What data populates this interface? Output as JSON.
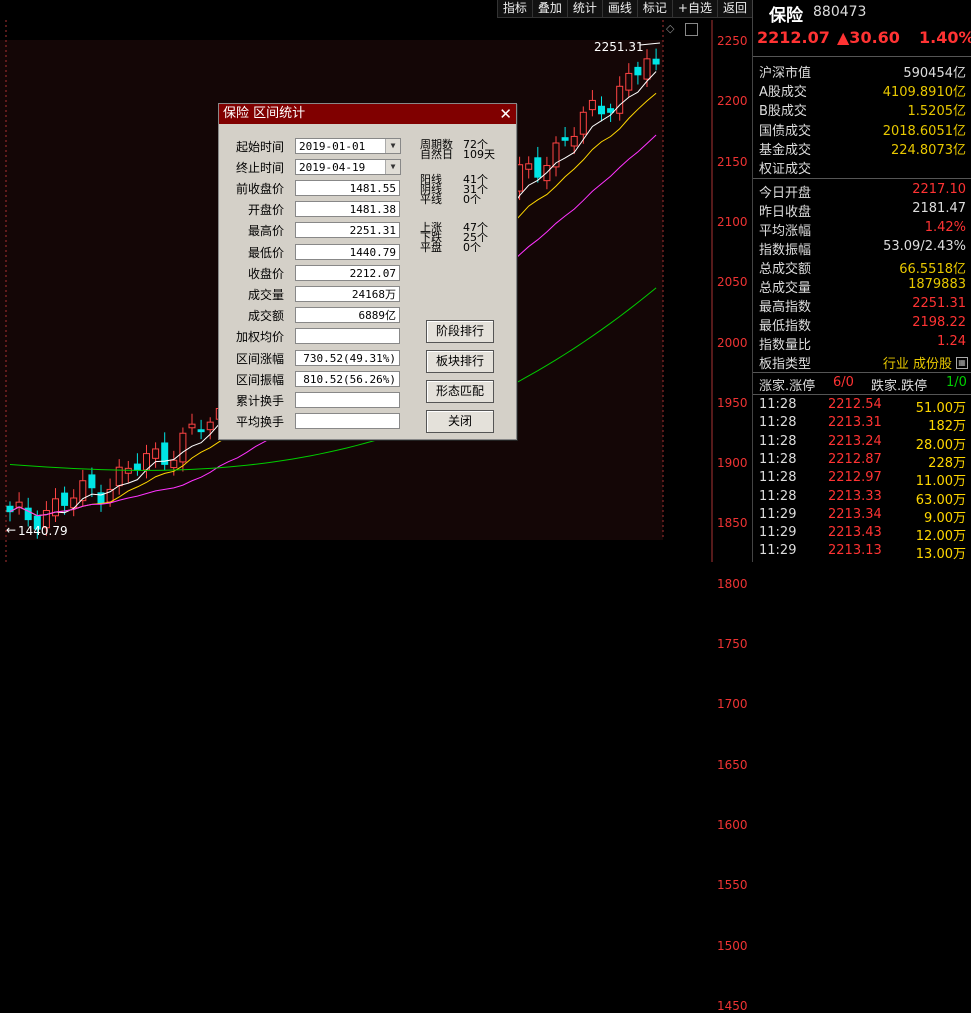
{
  "toolbar": {
    "items": [
      "指标",
      "叠加",
      "统计",
      "画线",
      "标记",
      "+自选",
      "返回"
    ]
  },
  "chart": {
    "price_axis": [
      "2250",
      "2200",
      "2150",
      "2100",
      "2050",
      "2000",
      "1950",
      "1900",
      "1850",
      "1800",
      "1750",
      "1700",
      "1650",
      "1600",
      "1550",
      "1500",
      "1450"
    ],
    "high_label": "2251.31",
    "low_label": "1440.79",
    "colors": {
      "up": "#ff4444",
      "down": "#00e5e5",
      "ma5": "#ffffff",
      "ma10": "#ffd700",
      "ma20": "#ff33ff",
      "ma60": "#00cc00"
    }
  },
  "panel": {
    "name": "保险",
    "code": "880473",
    "price": "2212.07",
    "change": "▲30.60",
    "change_pct": "1.40%",
    "rows1": [
      {
        "k": "沪深市值",
        "v": "590454亿",
        "c": "white"
      },
      {
        "k": "A股成交",
        "v": "4109.8910亿",
        "c": "yellow"
      },
      {
        "k": "B股成交",
        "v": "1.5205亿",
        "c": "yellow"
      },
      {
        "k": "国债成交",
        "v": "2018.6051亿",
        "c": "yellow"
      },
      {
        "k": "基金成交",
        "v": "224.8073亿",
        "c": "yellow"
      },
      {
        "k": "权证成交",
        "v": "",
        "c": "yellow"
      }
    ],
    "rows2": [
      {
        "k": "今日开盘",
        "v": "2217.10",
        "c": "red"
      },
      {
        "k": "昨日收盘",
        "v": "2181.47",
        "c": "white"
      },
      {
        "k": "平均涨幅",
        "v": "1.42%",
        "c": "red"
      },
      {
        "k": "指数振幅",
        "v": "53.09/2.43%",
        "c": "white"
      },
      {
        "k": "总成交额",
        "v": "66.5518亿",
        "c": "yellow"
      },
      {
        "k": "总成交量",
        "v": "1879883",
        "c": "yellow"
      },
      {
        "k": "最高指数",
        "v": "2251.31",
        "c": "red"
      },
      {
        "k": "最低指数",
        "v": "2198.22",
        "c": "red"
      },
      {
        "k": "指数量比",
        "v": "1.24",
        "c": "red"
      },
      {
        "k": "板指类型",
        "v": "行业 成份股",
        "c": "yellow"
      }
    ],
    "updown": {
      "k1": "涨家.涨停",
      "v1": "6/0",
      "k2": "跌家.跌停",
      "v2": "1/0"
    },
    "ticks": [
      {
        "t": "11:28",
        "p": "2212.54",
        "v": "51.00万"
      },
      {
        "t": "11:28",
        "p": "2213.31",
        "v": "182万"
      },
      {
        "t": "11:28",
        "p": "2213.24",
        "v": "28.00万"
      },
      {
        "t": "11:28",
        "p": "2212.87",
        "v": "228万"
      },
      {
        "t": "11:28",
        "p": "2212.97",
        "v": "11.00万"
      },
      {
        "t": "11:28",
        "p": "2213.33",
        "v": "63.00万"
      },
      {
        "t": "11:29",
        "p": "2213.34",
        "v": "9.00万"
      },
      {
        "t": "11:29",
        "p": "2213.43",
        "v": "12.00万"
      },
      {
        "t": "11:29",
        "p": "2213.13",
        "v": "13.00万"
      }
    ]
  },
  "dialog": {
    "title": "保险 区间统计",
    "close": "✕",
    "start_label": "起始时间",
    "start_value": "2019-01-01",
    "end_label": "终止时间",
    "end_value": "2019-04-19",
    "fields": [
      {
        "label": "前收盘价",
        "value": "1481.55"
      },
      {
        "label": "开盘价",
        "value": "1481.38"
      },
      {
        "label": "最高价",
        "value": "2251.31"
      },
      {
        "label": "最低价",
        "value": "1440.79"
      },
      {
        "label": "收盘价",
        "value": "2212.07"
      },
      {
        "label": "成交量",
        "value": "24168万"
      },
      {
        "label": "成交额",
        "value": "6889亿"
      },
      {
        "label": "加权均价",
        "value": ""
      },
      {
        "label": "区间涨幅",
        "value": "730.52(49.31%)"
      },
      {
        "label": "区间振幅",
        "value": "810.52(56.26%)"
      },
      {
        "label": "累计换手",
        "value": ""
      },
      {
        "label": "平均换手",
        "value": ""
      }
    ],
    "stats": [
      {
        "k": "周期数",
        "v": "72个"
      },
      {
        "k": "自然日",
        "v": "109天"
      },
      {
        "k": "阳线",
        "v": "41个"
      },
      {
        "k": "阴线",
        "v": "31个"
      },
      {
        "k": "平线",
        "v": "0个"
      },
      {
        "k": "上涨",
        "v": "47个"
      },
      {
        "k": "下跌",
        "v": "25个"
      },
      {
        "k": "平盘",
        "v": "0个"
      }
    ],
    "buttons": [
      "阶段排行",
      "板块排行",
      "形态匹配",
      "关闭"
    ]
  }
}
